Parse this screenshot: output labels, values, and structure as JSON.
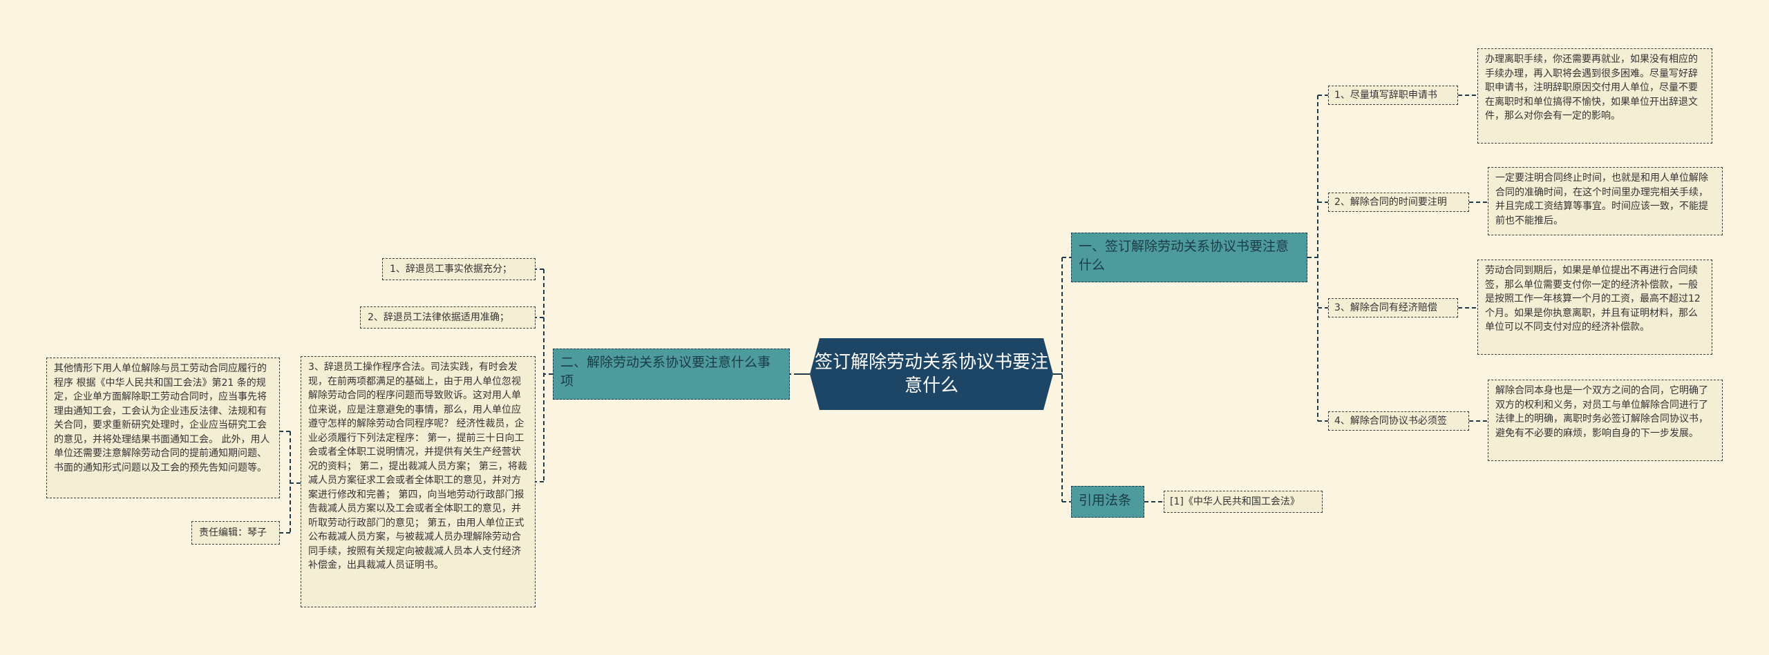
{
  "root": {
    "title": "签订解除劳动关系协议书要注意什么"
  },
  "colors": {
    "root_bg": "#1d4565",
    "branch_bg": "#4d9b9c",
    "leaf_bg": "#f4eed4",
    "background": "#fbf5e2"
  },
  "right": {
    "branch1": {
      "label": "一、签订解除劳动关系协议书要注意什么",
      "items": [
        {
          "label": "1、尽量填写辞职申请书",
          "detail": "办理离职手续，你还需要再就业，如果没有相应的手续办理，再入职将会遇到很多困难。尽量写好辞职申请书，注明辞职原因交付用人单位，尽量不要在离职时和单位搞得不愉快，如果单位开出辞退文件，那么对你会有一定的影响。"
        },
        {
          "label": "2、解除合同的时间要注明",
          "detail": "一定要注明合同终止时间，也就是和用人单位解除合同的准确时间，在这个时间里办理完相关手续，并且完成工资结算等事宜。时间应该一致，不能提前也不能推后。"
        },
        {
          "label": "3、解除合同有经济赔偿",
          "detail": "劳动合同到期后，如果是单位提出不再进行合同续签，那么单位需要支付你一定的经济补偿款，一般是按照工作一年核算一个月的工资，最高不超过12个月。如果是你执意离职，并且有证明材料，那么单位可以不同支付对应的经济补偿款。"
        },
        {
          "label": "4、解除合同协议书必须签",
          "detail": "解除合同本身也是一个双方之间的合同，它明确了双方的权利和义务，对员工与单位解除合同进行了法律上的明确，离职时务必签订解除合同协议书，避免有不必要的麻烦，影响自身的下一步发展。"
        }
      ]
    },
    "branch2": {
      "label": "引用法条",
      "items": [
        {
          "label": "[1]《中华人民共和国工会法》"
        }
      ]
    }
  },
  "left": {
    "branch": {
      "label": "二、解除劳动关系协议要注意什么事项",
      "items": [
        {
          "label": "1、辞退员工事实依据充分；"
        },
        {
          "label": "2、辞退员工法律依据适用准确；"
        },
        {
          "label": "3、辞退员工操作程序合法。司法实践，有时会发现，在前两项都满足的基础上，由于用人单位忽视解除劳动合同的程序问题而导致败诉。这对用人单位来说，应是注意避免的事情，那么，用人单位应遵守怎样的解除劳动合同程序呢？ 经济性裁员，企业必须履行下列法定程序： 第一，提前三十日向工会或者全体职工说明情况，并提供有关生产经营状况的资料； 第二，提出裁减人员方案； 第三，将裁减人员方案征求工会或者全体职工的意见，并对方案进行修改和完善； 第四，向当地劳动行政部门报告裁减人员方案以及工会或者全体职工的意见，并听取劳动行政部门的意见； 第五，由用人单位正式公布裁减人员方案，与被裁减人员办理解除劳动合同手续，按照有关规定向被裁减人员本人支付经济补偿金，出具裁减人员证明书。",
          "children": [
            {
              "label": "其他情形下用人单位解除与员工劳动合同应履行的程序 根据《中华人民共和国工会法》第21 条的规定，企业单方面解除职工劳动合同时，应当事先将理由通知工会，工会认为企业违反法律、法规和有关合同，要求重新研究处理时，企业应当研究工会的意见，并将处理结果书面通知工会。 此外，用人单位还需要注意解除劳动合同的提前通知期问题、书面的通知形式问题以及工会的预先告知问题等。"
            },
            {
              "label": "责任编辑：琴子"
            }
          ]
        }
      ]
    }
  }
}
